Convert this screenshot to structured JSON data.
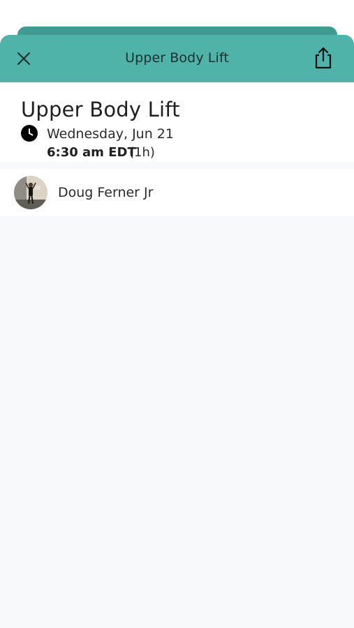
{
  "header": {
    "title": "Upper Body Lift",
    "close_icon": "close-icon",
    "share_icon": "share-icon",
    "color": "#4fb3aa"
  },
  "event": {
    "title": "Upper Body Lift",
    "date": "Wednesday, Jun 21",
    "time": "6:30 am EDT",
    "duration": "(1h)",
    "icon": "clock-icon"
  },
  "instructor": {
    "name": "Doug Ferner Jr"
  }
}
